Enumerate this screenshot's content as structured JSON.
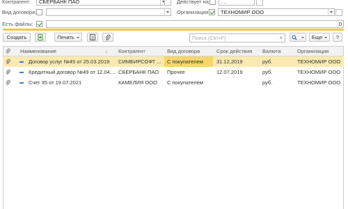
{
  "filters": {
    "counterparty_label": "Контрагент:",
    "counterparty_value": "СБЕРБАНК ПАО",
    "valid_on_label": "Действует на:",
    "valid_on_value": " .  .",
    "contract_type_label": "Вид договора:",
    "organization_label": "Организация:",
    "organization_value": "ТЕХНОМИР ООО",
    "has_files_label": "Есть файлы:",
    "progress_value": "0",
    "progress_fraction": 0
  },
  "toolbar": {
    "create_label": "Создать",
    "print_label": "Печать",
    "search_placeholder": "Поиск (Ctrl+F)",
    "more_label": "Еще",
    "help_label": "?"
  },
  "table": {
    "columns": [
      "Наименование",
      "Контрагент",
      "Вид договора",
      "Срок действия",
      "Валюта",
      "Организация"
    ],
    "sort_indicator": "↓",
    "rows": [
      {
        "name": "Договор услуг №45 от 25.03.2019",
        "counterparty": "СИМБИРСОФТ ...",
        "type": "С покупателем",
        "term": "31.12.2019",
        "currency": "руб.",
        "org": "ТЕХНОМИР ООО"
      },
      {
        "name": "Кредитный договор №49 от 12.04....",
        "counterparty": "СБЕРБАНК ПАО",
        "type": "Прочее",
        "term": "12.07.2019",
        "currency": "руб.",
        "org": "ТЕХНОМИР ООО"
      },
      {
        "name": "Счет 35 от 19.07.2021",
        "counterparty": "КАМЕЛИЯ ООО",
        "type": "С покупателем",
        "term": "",
        "currency": "руб.",
        "org": "ТЕХНОМИР ООО"
      }
    ]
  },
  "colors": {
    "selected_row": "#fbeab0",
    "highlight_cell": "#f6d66c",
    "progress_bar": "#f0c64a",
    "check": "#2a8a2a"
  }
}
